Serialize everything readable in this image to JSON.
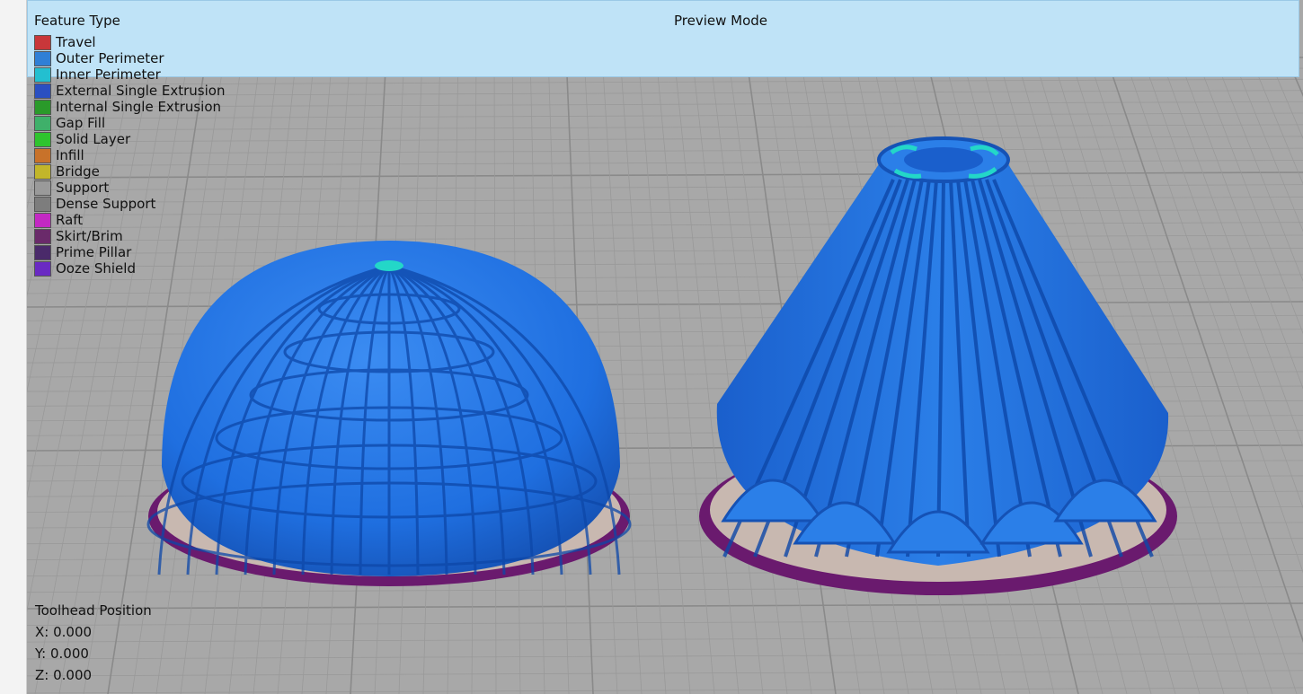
{
  "header": {
    "feature_type_label": "Feature Type",
    "preview_mode_label": "Preview Mode"
  },
  "legend": [
    {
      "label": "Travel",
      "color": "#c8373a"
    },
    {
      "label": "Outer Perimeter",
      "color": "#2f7fd6"
    },
    {
      "label": "Inner Perimeter",
      "color": "#23bfd0"
    },
    {
      "label": "External Single Extrusion",
      "color": "#2a4fc1"
    },
    {
      "label": "Internal Single Extrusion",
      "color": "#2a9a2a"
    },
    {
      "label": "Gap Fill",
      "color": "#3fb06a"
    },
    {
      "label": "Solid Layer",
      "color": "#2ec42e"
    },
    {
      "label": "Infill",
      "color": "#c8722a"
    },
    {
      "label": "Bridge",
      "color": "#c2b62a"
    },
    {
      "label": "Support",
      "color": "#9a9a9a"
    },
    {
      "label": "Dense Support",
      "color": "#7d7d7d"
    },
    {
      "label": "Raft",
      "color": "#c328c3"
    },
    {
      "label": "Skirt/Brim",
      "color": "#6a2a6a"
    },
    {
      "label": "Prime Pillar",
      "color": "#4a2a6a"
    },
    {
      "label": "Ooze Shield",
      "color": "#6a2ac3"
    }
  ],
  "toolhead": {
    "title": "Toolhead Position",
    "x": "X: 0.000",
    "y": "Y: 0.000",
    "z": "Z: 0.000"
  },
  "colors": {
    "model_blue": "#1f6fe0",
    "brim_purple": "#6a1a6e",
    "grid_bg": "#a8a8a8",
    "info_bar": "#bfe3f7"
  }
}
